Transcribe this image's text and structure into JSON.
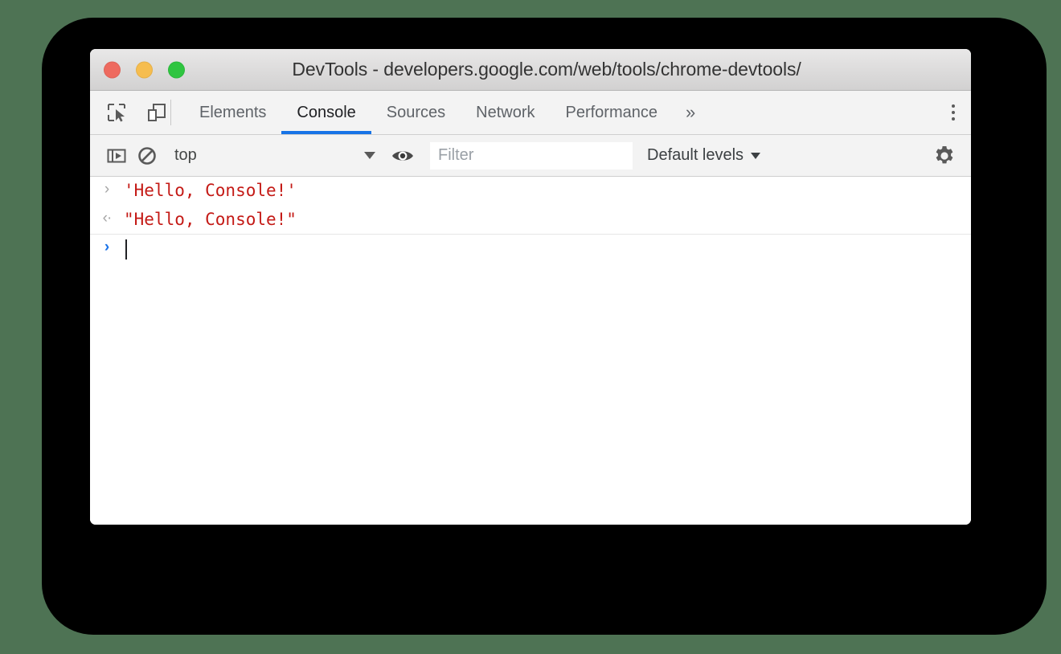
{
  "window": {
    "title": "DevTools - developers.google.com/web/tools/chrome-devtools/",
    "traffic_lights": [
      {
        "name": "close",
        "color": "#ee6a5f"
      },
      {
        "name": "minimize",
        "color": "#f6bd4f"
      },
      {
        "name": "zoom",
        "color": "#2fc540"
      }
    ]
  },
  "tabbar": {
    "icons": [
      {
        "name": "inspect-element-icon"
      },
      {
        "name": "device-toolbar-icon"
      }
    ],
    "tabs": [
      {
        "label": "Elements",
        "active": false
      },
      {
        "label": "Console",
        "active": true
      },
      {
        "label": "Sources",
        "active": false
      },
      {
        "label": "Network",
        "active": false
      },
      {
        "label": "Performance",
        "active": false
      }
    ],
    "overflow_label": "»",
    "menu_icon": "more-vertical-icon",
    "active_underline_color": "#1773e6"
  },
  "console_toolbar": {
    "sidebar_toggle_icon": "console-sidebar-icon",
    "clear_icon": "clear-console-icon",
    "context": {
      "label": "top",
      "caret": "▼"
    },
    "live_expression_icon": "eye-icon",
    "filter": {
      "value": "",
      "placeholder": "Filter"
    },
    "levels": {
      "label": "Default levels",
      "caret": "▼"
    },
    "settings_icon": "gear-icon"
  },
  "console": {
    "rows": [
      {
        "type": "input",
        "prompt": "›",
        "text": "'Hello, Console!'"
      },
      {
        "type": "result",
        "prompt": "‹·",
        "text": "\"Hello, Console!\""
      },
      {
        "type": "prompt",
        "prompt": "›",
        "text": ""
      }
    ],
    "string_color": "#c41a16"
  },
  "colors": {
    "page_background": "#4e7354",
    "backdrop": "#000000",
    "toolbar_background": "#f3f3f3",
    "accent_blue": "#1a73e8"
  }
}
